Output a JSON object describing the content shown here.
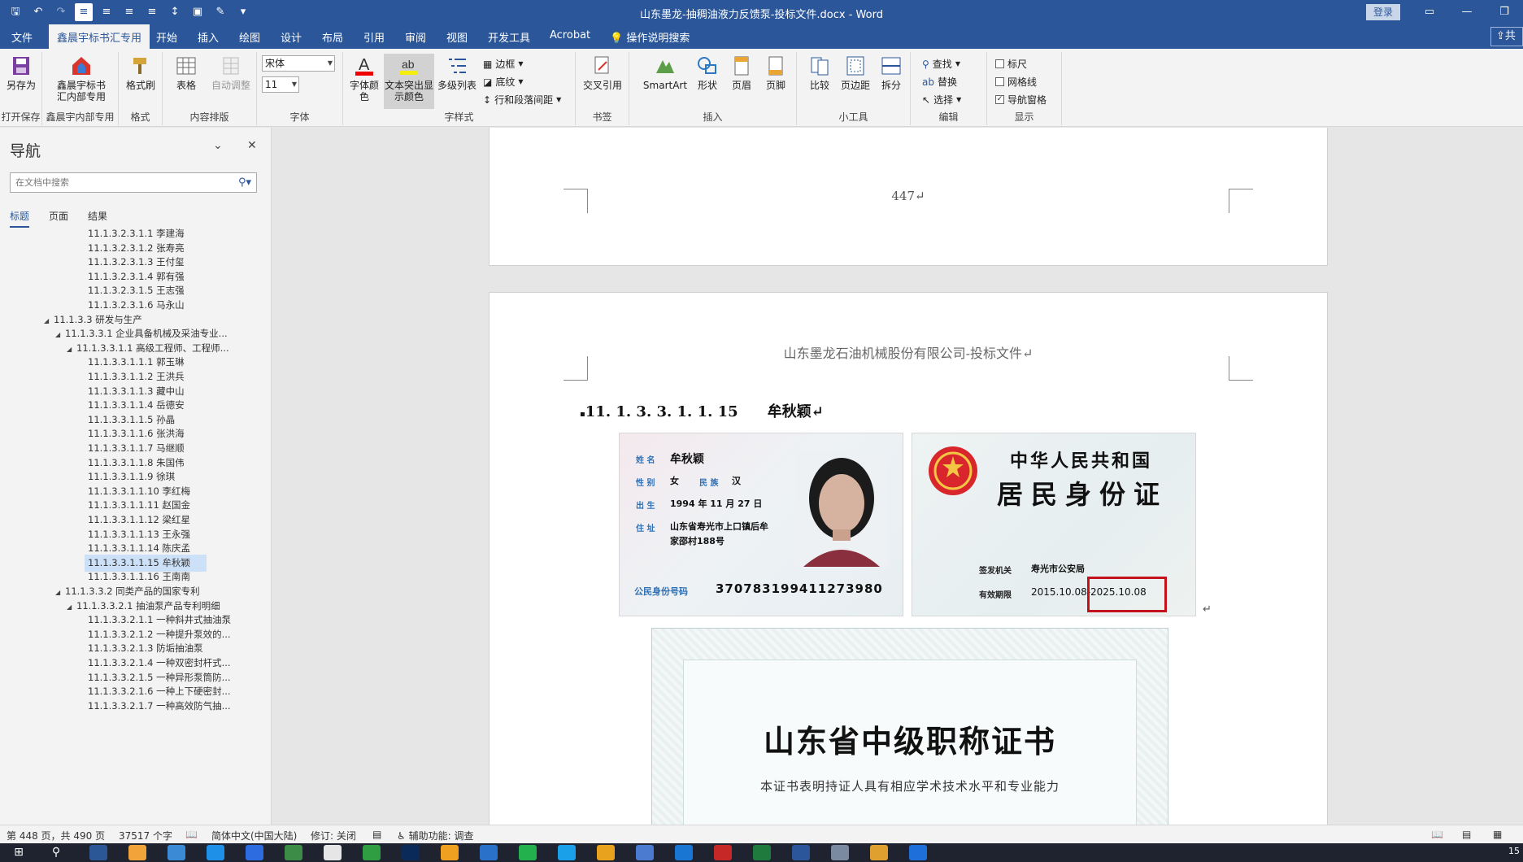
{
  "window": {
    "doc_title": "山东墨龙-抽稠油液力反馈泵-投标文件.docx  -  Word",
    "login_label": "登录"
  },
  "tabs": [
    "文件",
    "鑫晨宇标书汇专用",
    "开始",
    "插入",
    "绘图",
    "设计",
    "布局",
    "引用",
    "审阅",
    "视图",
    "开发工具",
    "Acrobat",
    "操作说明搜索"
  ],
  "share_label": "共",
  "ribbon": {
    "saveas": "另存为",
    "group_open_save": "打开保存",
    "xcy_btn_line1": "鑫晨宇标书",
    "xcy_btn_line2": "汇内部专用",
    "group_xcy": "鑫晨宇内部专用",
    "format_painter": "格式刷",
    "group_format": "格式",
    "table": "表格",
    "autofit": "自动调整",
    "group_layout": "内容排版",
    "font_name": "宋体",
    "font_size": "11",
    "group_font": "字体",
    "font_color_line1": "字体颜",
    "font_color_line2": "色",
    "highlight_line1": "文本突出显",
    "highlight_line2": "示颜色",
    "multilevel": "多级列表",
    "border": "边框",
    "shading": "底纹",
    "para_spacing": "行和段落间距",
    "group_style": "字样式",
    "cross_ref": "交叉引用",
    "group_bookmark": "书签",
    "smartart": "SmartArt",
    "shape": "形状",
    "header": "页眉",
    "footer": "页脚",
    "group_insert": "插入",
    "compare": "比较",
    "margin": "页边距",
    "split": "拆分",
    "group_tools": "小工具",
    "find": "查找",
    "replace": "替换",
    "select": "选择",
    "group_edit": "编辑",
    "ruler": "标尺",
    "gridlines": "网格线",
    "nav_pane": "导航窗格",
    "group_show": "显示"
  },
  "nav": {
    "title": "导航",
    "search_placeholder": "在文档中搜索",
    "tabs": [
      "标题",
      "页面",
      "结果"
    ],
    "items": [
      {
        "text": "11.1.3.2.3.1.1 李建海",
        "level": 3,
        "tri": ""
      },
      {
        "text": "11.1.3.2.3.1.2 张寿亮",
        "level": 3,
        "tri": ""
      },
      {
        "text": "11.1.3.2.3.1.3 王付玺",
        "level": 3,
        "tri": ""
      },
      {
        "text": "11.1.3.2.3.1.4 郭有强",
        "level": 3,
        "tri": ""
      },
      {
        "text": "11.1.3.2.3.1.5 王志强",
        "level": 3,
        "tri": ""
      },
      {
        "text": "11.1.3.2.3.1.6 马永山",
        "level": 3,
        "tri": ""
      },
      {
        "text": "11.1.3.3 研发与生产",
        "level": 0,
        "tri": "◢"
      },
      {
        "text": "11.1.3.3.1 企业具备机械及采油专业...",
        "level": 1,
        "tri": "◢"
      },
      {
        "text": "11.1.3.3.1.1 高级工程师、工程师...",
        "level": 2,
        "tri": "◢"
      },
      {
        "text": "11.1.3.3.1.1.1 郭玉琳",
        "level": 3,
        "tri": ""
      },
      {
        "text": "11.1.3.3.1.1.2 王洪兵",
        "level": 3,
        "tri": ""
      },
      {
        "text": "11.1.3.3.1.1.3 藏中山",
        "level": 3,
        "tri": ""
      },
      {
        "text": "11.1.3.3.1.1.4 岳德安",
        "level": 3,
        "tri": ""
      },
      {
        "text": "11.1.3.3.1.1.5 孙晶",
        "level": 3,
        "tri": ""
      },
      {
        "text": "11.1.3.3.1.1.6 张洪海",
        "level": 3,
        "tri": ""
      },
      {
        "text": "11.1.3.3.1.1.7 马继顺",
        "level": 3,
        "tri": ""
      },
      {
        "text": "11.1.3.3.1.1.8 朱国伟",
        "level": 3,
        "tri": ""
      },
      {
        "text": "11.1.3.3.1.1.9 徐琪",
        "level": 3,
        "tri": ""
      },
      {
        "text": "11.1.3.3.1.1.10 李红梅",
        "level": 3,
        "tri": ""
      },
      {
        "text": "11.1.3.3.1.1.11 赵国金",
        "level": 3,
        "tri": ""
      },
      {
        "text": "11.1.3.3.1.1.12 梁红星",
        "level": 3,
        "tri": ""
      },
      {
        "text": "11.1.3.3.1.1.13 王永强",
        "level": 3,
        "tri": ""
      },
      {
        "text": "11.1.3.3.1.1.14 陈庆孟",
        "level": 3,
        "tri": ""
      },
      {
        "text": "11.1.3.3.1.1.15 牟秋颖",
        "level": 3,
        "tri": "",
        "selected": true
      },
      {
        "text": "11.1.3.3.1.1.16 王南南",
        "level": 3,
        "tri": ""
      },
      {
        "text": "11.1.3.3.2 同类产品的国家专利",
        "level": 1,
        "tri": "◢"
      },
      {
        "text": "11.1.3.3.2.1 抽油泵产品专利明细",
        "level": 2,
        "tri": "◢"
      },
      {
        "text": "11.1.3.3.2.1.1 一种斜井式抽油泵",
        "level": 3,
        "tri": ""
      },
      {
        "text": "11.1.3.3.2.1.2 一种提升泵效的...",
        "level": 3,
        "tri": ""
      },
      {
        "text": "11.1.3.3.2.1.3 防垢抽油泵",
        "level": 3,
        "tri": ""
      },
      {
        "text": "11.1.3.3.2.1.4 一种双密封杆式...",
        "level": 3,
        "tri": ""
      },
      {
        "text": "11.1.3.3.2.1.5 一种异形泵筒防...",
        "level": 3,
        "tri": ""
      },
      {
        "text": "11.1.3.3.2.1.6 一种上下硬密封...",
        "level": 3,
        "tri": ""
      },
      {
        "text": "11.1.3.3.2.1.7 一种高效防气抽...",
        "level": 3,
        "tri": ""
      }
    ]
  },
  "document": {
    "prev_page_number": "447↵",
    "header_text": "山东墨龙石油机械股份有限公司-投标文件↵",
    "heading": "11. 1. 3. 3. 1. 1. 15　　牟秋颖↵",
    "id_front": {
      "name_label": "姓 名",
      "name": "牟秋颖",
      "sex_label": "性 别",
      "sex": "女",
      "ethnic_label": "民 族",
      "ethnic": "汉",
      "birth_label": "出 生",
      "birth": "1994  年  11 月 27 日",
      "addr_label": "住 址",
      "addr_line1": "山东省寿光市上口镇后牟",
      "addr_line2": "家邵村188号",
      "id_label": "公民身份号码",
      "id_number": "370783199411273980"
    },
    "id_back": {
      "title1": "中华人民共和国",
      "title2": "居民身份证",
      "authority_label": "签发机关",
      "authority": "寿光市公安局",
      "validity_label": "有效期限",
      "validity_start": "2015.10.08-",
      "validity_end": "2025.10.08"
    },
    "para_mark": "↵",
    "cert_title": "山东省中级职称证书",
    "cert_subtitle": "本证书表明持证人具有相应学术技术水平和专业能力"
  },
  "status": {
    "page": "第 448 页，共 490 页",
    "words": "37517 个字",
    "lang": "简体中文(中国大陆)",
    "track": "修订: 关闭",
    "accessibility": "辅助功能: 调查"
  },
  "taskbar": {
    "clock": "15"
  }
}
